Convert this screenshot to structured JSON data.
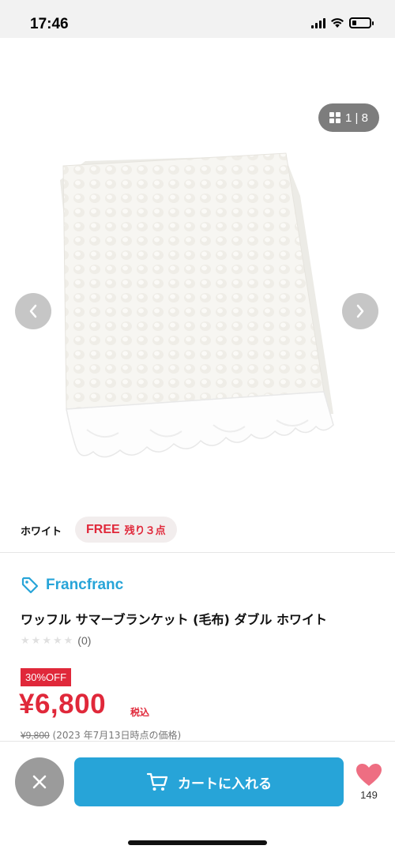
{
  "status_bar": {
    "time": "17:46",
    "icons": [
      "signal-icon",
      "wifi-icon",
      "battery-icon"
    ],
    "battery_level": 0.25
  },
  "gallery": {
    "counter": "1 | 8",
    "prev_icon": "chevron-left-icon",
    "next_icon": "chevron-right-icon",
    "grid_icon": "grid-icon"
  },
  "variant": {
    "color": "ホワイト",
    "size": "FREE",
    "stock": "残り３点"
  },
  "product": {
    "brand": "Francfranc",
    "brand_icon": "tag-icon",
    "title": "ワッフル サマーブランケット (毛布) ダブル ホワイト",
    "rating": 0,
    "rating_max": 5,
    "review_count": "(0)",
    "discount": "30%OFF",
    "price": "¥6,800",
    "tax_label": "税込",
    "original_price": "¥9,800",
    "original_note": "(2023 年7月13日時点の価格)"
  },
  "actions": {
    "close_icon": "close-icon",
    "cart_icon": "cart-icon",
    "cart_label": "カートに入れる",
    "favorite_icon": "heart-icon",
    "favorite_count": "149"
  },
  "colors": {
    "accent_blue": "#27a4d8",
    "sale_red": "#e0283a",
    "favorite_pink": "#ee6e82",
    "close_gray": "#9b9b9b"
  }
}
